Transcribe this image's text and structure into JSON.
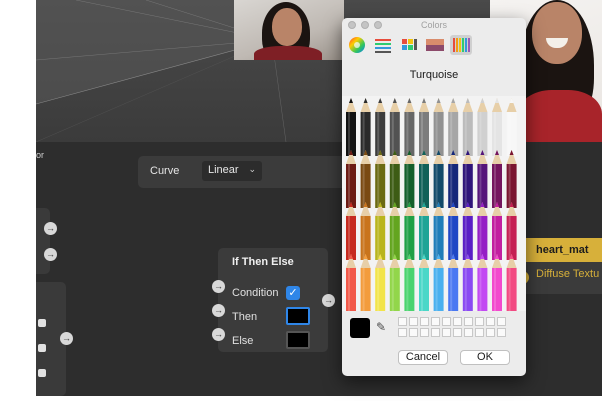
{
  "colors_panel": {
    "title": "Colors",
    "selected_color_name": "Turquoise",
    "cancel_label": "Cancel",
    "ok_label": "OK",
    "selected_color": "#000000",
    "toolbar_tabs": [
      {
        "name": "color-wheel-tab",
        "selected": false
      },
      {
        "name": "color-sliders-tab",
        "selected": false
      },
      {
        "name": "color-palettes-tab",
        "selected": false
      },
      {
        "name": "image-palettes-tab",
        "selected": false
      },
      {
        "name": "pencils-tab",
        "selected": true
      }
    ],
    "pencil_colors": [
      [
        "#111111",
        "#2a2a2a",
        "#3d3d3d",
        "#525252",
        "#676767",
        "#7c7c7c",
        "#919191",
        "#a6a6a6",
        "#bbbbbb",
        "#d0d0d0",
        "#e4e4e4",
        "#f7f7f7"
      ],
      [
        "#6d1b14",
        "#7a4a12",
        "#6b6a12",
        "#3d5c14",
        "#135f2c",
        "#126158",
        "#124a6a",
        "#15287a",
        "#2f157a",
        "#55157a",
        "#74155e",
        "#7a1530"
      ],
      [
        "#c62a1f",
        "#c9741c",
        "#b9b51d",
        "#63a51f",
        "#1fa046",
        "#1fa496",
        "#1f7db9",
        "#1f47c5",
        "#5a1fc5",
        "#951fc5",
        "#c21fa0",
        "#c51f53"
      ],
      [
        "#f2594a",
        "#f39c3c",
        "#f2e44a",
        "#92d64a",
        "#4ad36e",
        "#4ad7c8",
        "#4ab0ef",
        "#4a78f2",
        "#8a4af2",
        "#c24af2",
        "#f24acd",
        "#f24a82"
      ]
    ]
  },
  "graph_editor": {
    "panel_title": "or",
    "curve_label": "Curve",
    "curve_value": "Linear",
    "if_then_else": {
      "title": "If Then Else",
      "condition_label": "Condition",
      "condition_checked": true,
      "then_label": "Then",
      "else_label": "Else"
    },
    "material": {
      "name": "heart_mat",
      "input_label": "Diffuse Textu"
    }
  }
}
